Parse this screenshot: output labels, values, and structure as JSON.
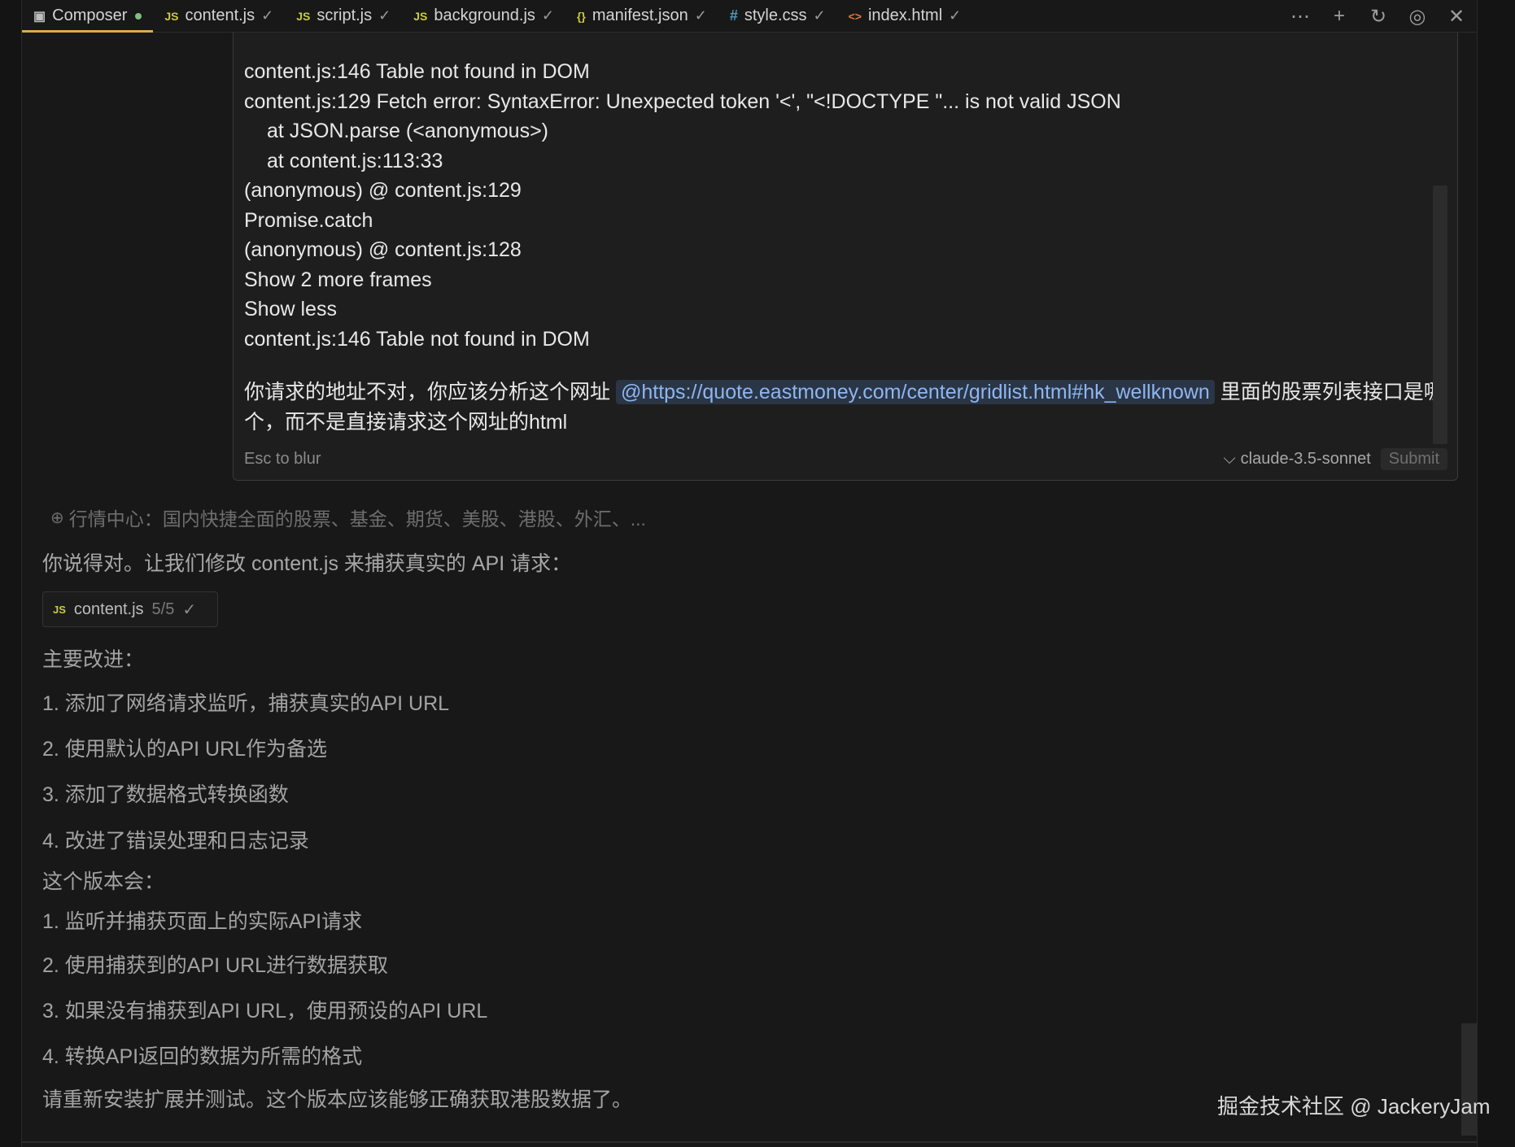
{
  "tabs": [
    {
      "label": "Composer",
      "icon": "composer-icon",
      "icon_glyph": "▣",
      "active": true,
      "status": "modified-dot"
    },
    {
      "label": "content.js",
      "icon": "js-file-icon",
      "icon_glyph": "JS",
      "check": "✓"
    },
    {
      "label": "script.js",
      "icon": "js-file-icon",
      "icon_glyph": "JS",
      "check": "✓"
    },
    {
      "label": "background.js",
      "icon": "js-file-icon",
      "icon_glyph": "JS",
      "check": "✓"
    },
    {
      "label": "manifest.json",
      "icon": "json-file-icon",
      "icon_glyph": "{}",
      "check": "✓"
    },
    {
      "label": "style.css",
      "icon": "css-file-icon",
      "icon_glyph": "#",
      "check": "✓"
    },
    {
      "label": "index.html",
      "icon": "html-file-icon",
      "icon_glyph": "<>",
      "check": "✓"
    }
  ],
  "tab_actions": {
    "more": "⋯",
    "new": "+",
    "history": "↻",
    "settings": "◎",
    "close": "✕"
  },
  "input": {
    "console_lines": [
      {
        "text": "content.js:146 Table not found in DOM",
        "indent": false
      },
      {
        "text": "content.js:129 Fetch error: SyntaxError: Unexpected token '<', \"<!DOCTYPE \"... is not valid JSON",
        "indent": false
      },
      {
        "text": "at JSON.parse (<anonymous>)",
        "indent": true
      },
      {
        "text": "at content.js:113:33",
        "indent": true
      },
      {
        "text": "(anonymous) @ content.js:129",
        "indent": false
      },
      {
        "text": "Promise.catch",
        "indent": false
      },
      {
        "text": "(anonymous) @ content.js:128",
        "indent": false
      },
      {
        "text": "Show 2 more frames",
        "indent": false
      },
      {
        "text": "Show less",
        "indent": false
      },
      {
        "text": "content.js:146 Table not found in DOM",
        "indent": false
      }
    ],
    "user_message_before": "你请求的地址不对，你应该分析这个网址",
    "mention": "@https://quote.eastmoney.com/center/gridlist.html#hk_wellknown",
    "user_message_after": " 里面的股票列表接口是哪个，而不是直接请求这个网址的html",
    "blur_hint": "Esc to blur",
    "model": "claude-3.5-sonnet",
    "model_chevron": "⌵",
    "submit": "Submit"
  },
  "response": {
    "web_ref": "行情中心：国内快捷全面的股票、基金、期货、美股、港股、外汇、...",
    "web_ref_icon": "⊕",
    "intro": "你说得对。让我们修改 content.js 来捕获真实的 API 请求：",
    "file_chip": {
      "icon_glyph": "JS",
      "name": "content.js",
      "count": "5/5",
      "check": "✓"
    },
    "improvements_title": "主要改进：",
    "improvements": [
      "1. 添加了网络请求监听，捕获真实的API URL",
      "2. 使用默认的API URL作为备选",
      "3. 添加了数据格式转换函数",
      "4. 改进了错误处理和日志记录"
    ],
    "version_title": "这个版本会：",
    "version_items": [
      "1. 监听并捕获页面上的实际API请求",
      "2. 使用捕获到的API URL进行数据获取",
      "3. 如果没有捕获到API URL，使用预设的API URL",
      "4. 转换API返回的数据为所需的格式"
    ],
    "closing": "请重新安装扩展并测试。这个版本应该能够正确获取港股数据了。"
  },
  "watermark": "掘金技术社区 @ JackeryJam"
}
